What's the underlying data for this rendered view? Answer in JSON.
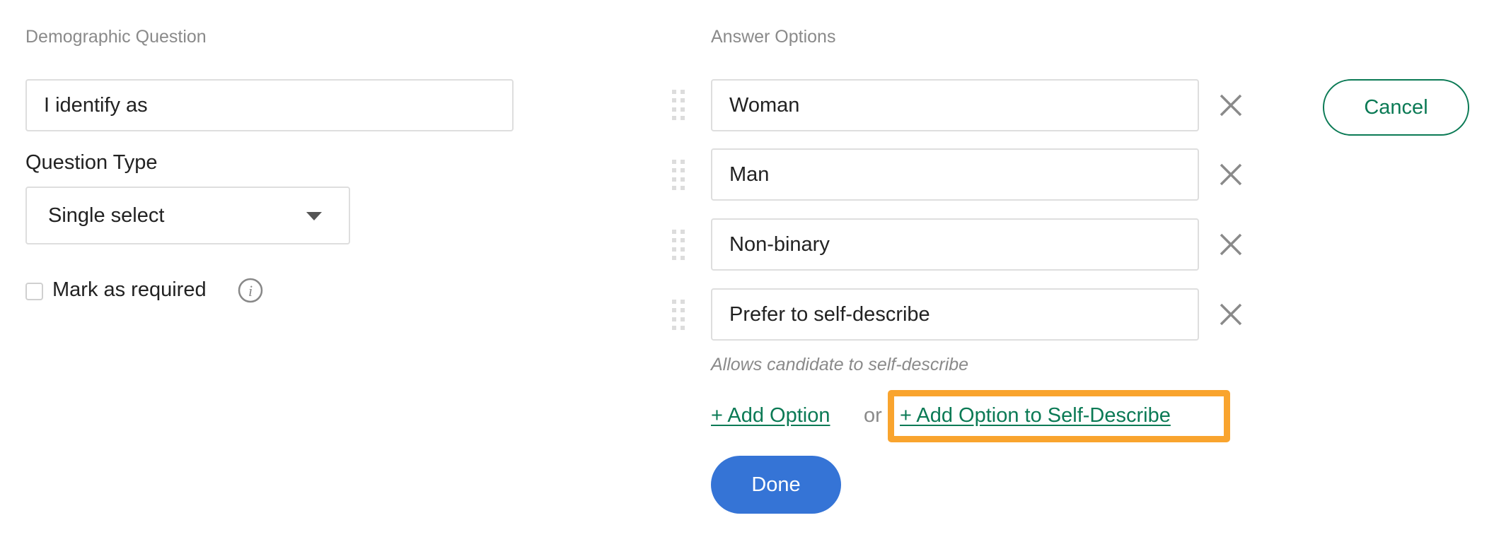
{
  "left": {
    "heading": "Demographic Question",
    "question_value": "I identify as",
    "type_label": "Question Type",
    "type_value": "Single select",
    "required_label": "Mark as required",
    "required_checked": false
  },
  "right": {
    "heading": "Answer Options",
    "options": [
      {
        "value": "Woman"
      },
      {
        "value": "Man"
      },
      {
        "value": "Non-binary"
      },
      {
        "value": "Prefer to self-describe"
      }
    ],
    "hint": "Allows candidate to self-describe",
    "add_option": "+ Add Option",
    "or": "or",
    "add_self_describe": "+ Add Option to Self-Describe",
    "done": "Done",
    "cancel": "Cancel"
  },
  "colors": {
    "accent_green": "#0b7a55",
    "primary_blue": "#3574d6",
    "highlight_orange": "#f9a42e"
  }
}
